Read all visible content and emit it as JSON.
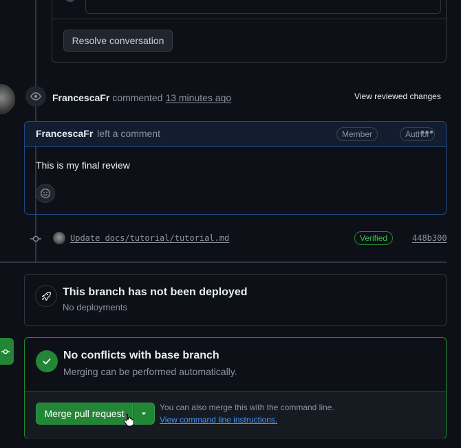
{
  "top": {
    "resolve_label": "Resolve conversation"
  },
  "review": {
    "author": "FrancescaFr",
    "action": "commented",
    "time": "13 minutes ago",
    "view_changes": "View reviewed changes"
  },
  "comment": {
    "author": "FrancescaFr",
    "action": "left a comment",
    "badges": [
      "Member",
      "Author"
    ],
    "body": "This is my final review"
  },
  "commit": {
    "message": "Update docs/tutorial/tutorial.md",
    "verified": "Verified",
    "sha": "448b300"
  },
  "deploy": {
    "title": "This branch has not been deployed",
    "subtitle": "No deployments"
  },
  "merge": {
    "title": "No conflicts with base branch",
    "subtitle": "Merging can be performed automatically.",
    "button": "Merge pull request",
    "hint": "You can also merge this with the command line.",
    "hint_link": "View command line instructions."
  },
  "colors": {
    "accent_green": "#238636",
    "link_blue": "#4493f8",
    "border": "#30363d"
  }
}
